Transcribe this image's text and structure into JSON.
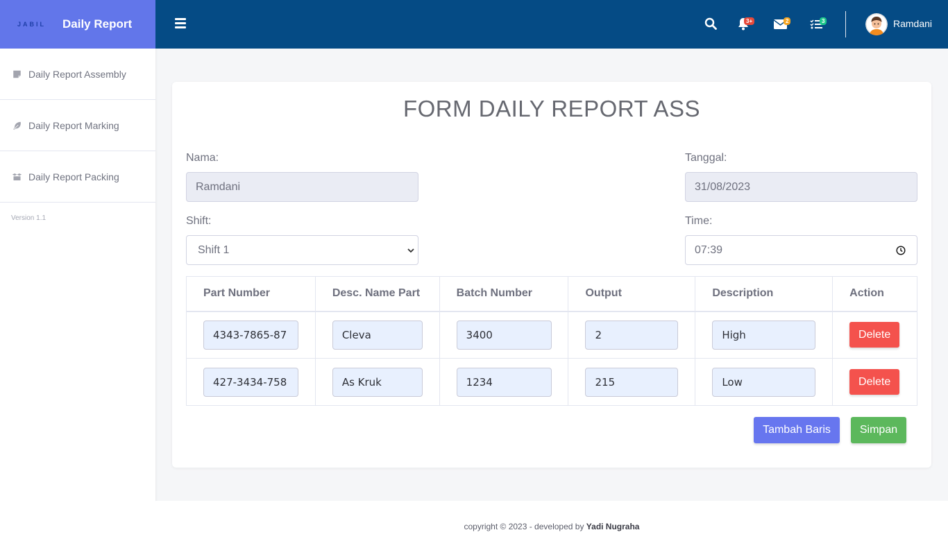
{
  "brand": {
    "logo_text": "JABIL",
    "title": "Daily Report",
    "color": "#6276ea"
  },
  "sidebar": {
    "items": [
      {
        "label": "Daily Report Assembly",
        "icon": "sticky-note-icon"
      },
      {
        "label": "Daily Report Marking",
        "icon": "feather-icon"
      },
      {
        "label": "Daily Report Packing",
        "icon": "box-open-icon"
      }
    ],
    "version": "Version 1.1"
  },
  "topbar": {
    "color": "#054b85",
    "alerts_badge": "3+",
    "messages_badge": "2",
    "tasks_badge": "3",
    "username": "Ramdani"
  },
  "form": {
    "title": "FORM DAILY REPORT ASS",
    "nama_label": "Nama:",
    "nama_value": "Ramdani",
    "tanggal_label": "Tanggal:",
    "tanggal_value": "31/08/2023",
    "shift_label": "Shift:",
    "shift_value": "Shift 1",
    "time_label": "Time:",
    "time_value": "07:39"
  },
  "table": {
    "headers": [
      "Part Number",
      "Desc. Name Part",
      "Batch Number",
      "Output",
      "Description",
      "Action"
    ],
    "rows": [
      {
        "part_number": "4343-7865-87",
        "desc_name": "Cleva",
        "batch": "3400",
        "output": "2",
        "description": "High",
        "action": "Delete"
      },
      {
        "part_number": "427-3434-758",
        "desc_name": "As Kruk",
        "batch": "1234",
        "output": "215",
        "description": "Low",
        "action": "Delete"
      }
    ]
  },
  "buttons": {
    "add_row": "Tambah Baris",
    "save": "Simpan"
  },
  "footer": {
    "prefix": "copyright © 2023 - developed by ",
    "author": "Yadi Nugraha"
  }
}
